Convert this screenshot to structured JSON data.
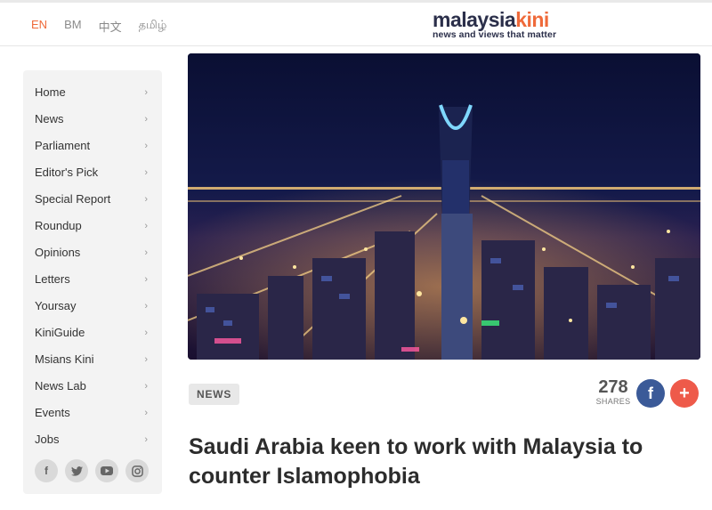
{
  "header": {
    "languages": [
      "EN",
      "BM",
      "中文",
      "தமிழ்"
    ],
    "active_language": "EN",
    "logo_part1": "malaysia",
    "logo_part2": "kini",
    "tagline": "news and views that matter"
  },
  "sidebar": {
    "items": [
      {
        "label": "Home"
      },
      {
        "label": "News"
      },
      {
        "label": "Parliament"
      },
      {
        "label": "Editor's Pick"
      },
      {
        "label": "Special Report"
      },
      {
        "label": "Roundup"
      },
      {
        "label": "Opinions"
      },
      {
        "label": "Letters"
      },
      {
        "label": "Yoursay"
      },
      {
        "label": "KiniGuide"
      },
      {
        "label": "Msians Kini"
      },
      {
        "label": "News Lab"
      },
      {
        "label": "Events"
      },
      {
        "label": "Jobs"
      }
    ],
    "social_icons": [
      "facebook-icon",
      "twitter-icon",
      "youtube-icon",
      "instagram-icon"
    ]
  },
  "article": {
    "category": "NEWS",
    "shares_count": "278",
    "shares_label": "SHARES",
    "headline": "Saudi Arabia keen to work with Malaysia to counter Islamophobia"
  },
  "colors": {
    "accent": "#ef6a3a",
    "brand_dark": "#2b2f4a",
    "facebook": "#3b5a98",
    "share_plus": "#ee5a4a"
  }
}
